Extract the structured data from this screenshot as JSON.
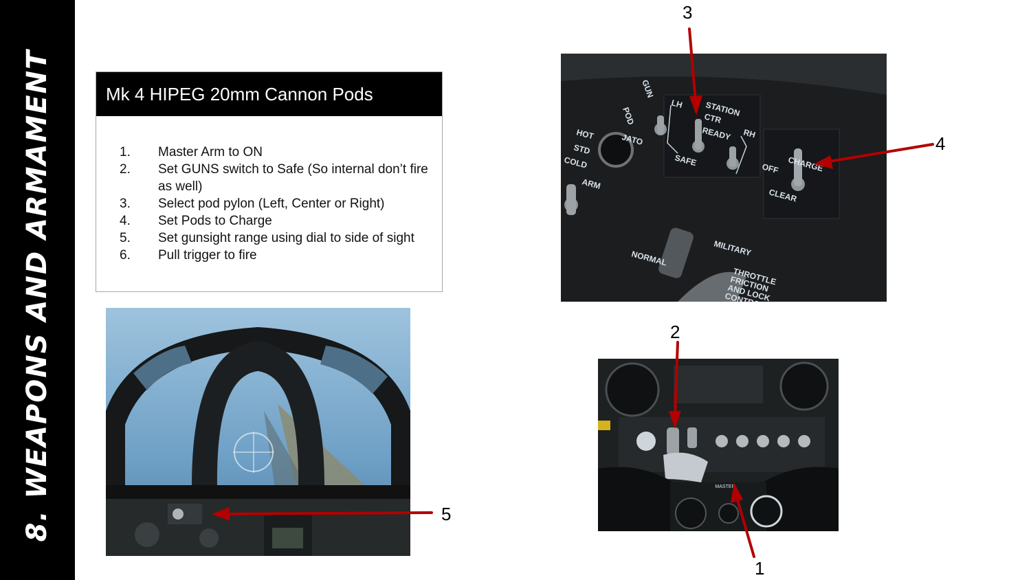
{
  "slide": {
    "side_title": "8. Weapons and Armament"
  },
  "info_box": {
    "title": "Mk 4 HIPEG 20mm Cannon Pods",
    "steps": [
      {
        "num": "1.",
        "text": "Master Arm to ON"
      },
      {
        "num": "2.",
        "text": "Set GUNS switch to Safe (So internal don’t fire as well)"
      },
      {
        "num": "3.",
        "text": "Select pod pylon (Left, Center or Right)"
      },
      {
        "num": "4.",
        "text": "Set Pods to Charge"
      },
      {
        "num": "5.",
        "text": "Set gunsight range using dial to side of sight"
      },
      {
        "num": "6.",
        "text": "Pull trigger to fire"
      }
    ]
  },
  "callouts": {
    "c1": "1",
    "c2": "2",
    "c3": "3",
    "c4": "4",
    "c5": "5"
  },
  "panel_labels": {
    "gun": "GUN",
    "pod": "POD",
    "hot": "HOT",
    "std": "STD",
    "cold": "COLD",
    "jato": "JATO",
    "lh": "LH",
    "station": "STATION",
    "ctr": "CTR",
    "ready": "READY",
    "rh": "RH",
    "safe": "SAFE",
    "off": "OFF",
    "charge": "CHARGE",
    "clear": "CLEAR",
    "arm": "ARM",
    "normal": "NORMAL",
    "military": "MILITARY",
    "throttle": "THROTTLE",
    "friction": "FRICTION",
    "and_lock": "AND LOCK",
    "control": "CONTROL",
    "master": "MASTER"
  },
  "colors": {
    "arrow": "#b30000",
    "banner": "#000000"
  }
}
